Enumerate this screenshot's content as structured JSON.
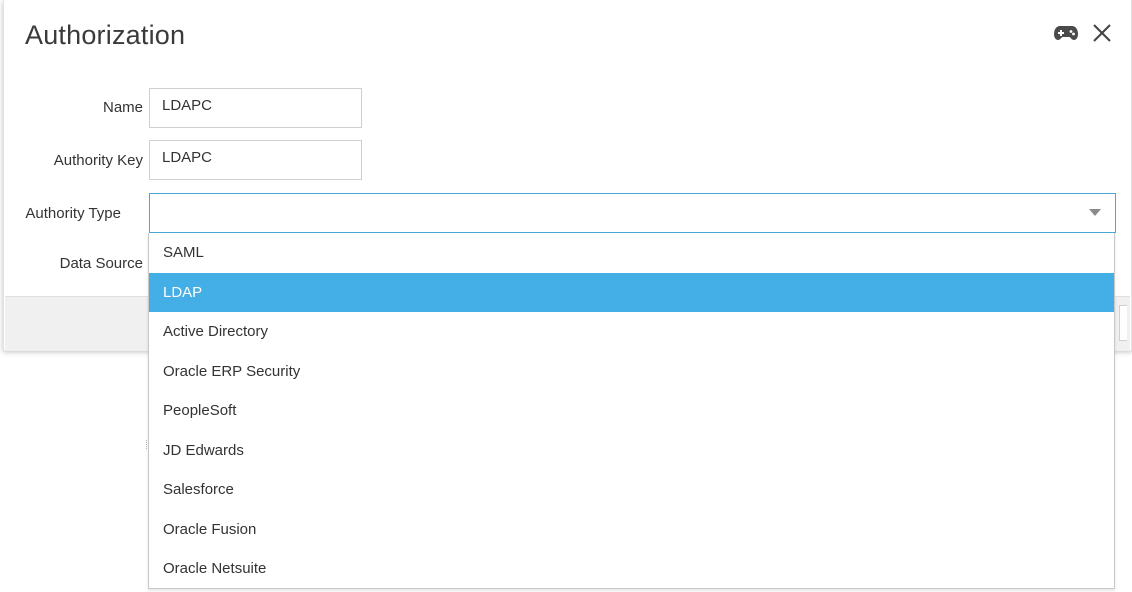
{
  "dialog": {
    "title": "Authorization"
  },
  "header": {
    "icons": [
      "gamepad-icon",
      "close-icon"
    ]
  },
  "form": {
    "name_label": "Name",
    "name_value": "LDAPC",
    "authority_key_label": "Authority Key",
    "authority_key_value": "LDAPC",
    "authority_type_label": "Authority Type",
    "authority_type_value": "",
    "data_source_label": "Data Source"
  },
  "dropdown": {
    "options": [
      "SAML",
      "LDAP",
      "Active Directory",
      "Oracle ERP Security",
      "PeopleSoft",
      "JD Edwards",
      "Salesforce",
      "Oracle Fusion",
      "Oracle Netsuite"
    ],
    "highlighted": "LDAP"
  },
  "colors": {
    "highlight": "#44aee6",
    "focus_border": "#4aa6d6",
    "footer_band": "#f0f0f0",
    "text": "#333333"
  }
}
